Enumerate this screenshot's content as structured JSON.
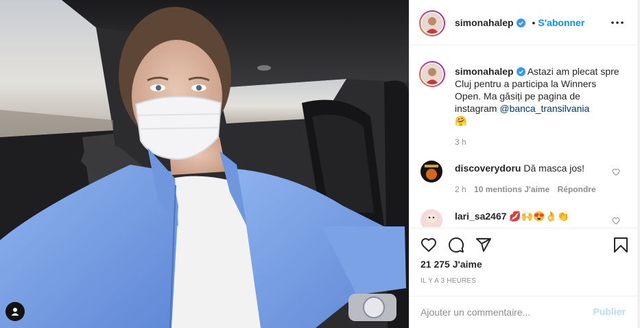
{
  "colors": {
    "accent": "#0095f6",
    "link": "#00376b",
    "muted": "#8e8e8e",
    "publish_disabled": "#b2dffc",
    "jacket": "#7ea6e6"
  },
  "photo": {
    "user_tag_icon": "user-tag-icon"
  },
  "header": {
    "username": "simonahalep",
    "separator": "•",
    "follow_label": "S'abonner",
    "more_icon": "more-horizontal-icon"
  },
  "caption": {
    "username": "simonahalep",
    "text": "Astazi am plecat spre Cluj pentru a participa la Winners Open. Ma găsiți pe pagina de instagram ",
    "mention": "@banca_transilvania",
    "emoji": "🤗",
    "time": "3 h"
  },
  "comments": [
    {
      "username": "discoverydoru",
      "text": "Dă masca jos!",
      "time": "2 h",
      "likes": "10 mentions J'aime",
      "reply_label": "Répondre"
    },
    {
      "username": "lari_sa2467",
      "text": "💋🙌😍👌👏"
    }
  ],
  "actions": {
    "like_icon": "heart-icon",
    "comment_icon": "comment-icon",
    "share_icon": "share-icon",
    "save_icon": "bookmark-icon",
    "likes": "21 275 J'aime",
    "time_ago": "IL Y A 3 HEURES"
  },
  "comment_box": {
    "placeholder": "Ajouter un commentaire...",
    "publish_label": "Publier"
  }
}
